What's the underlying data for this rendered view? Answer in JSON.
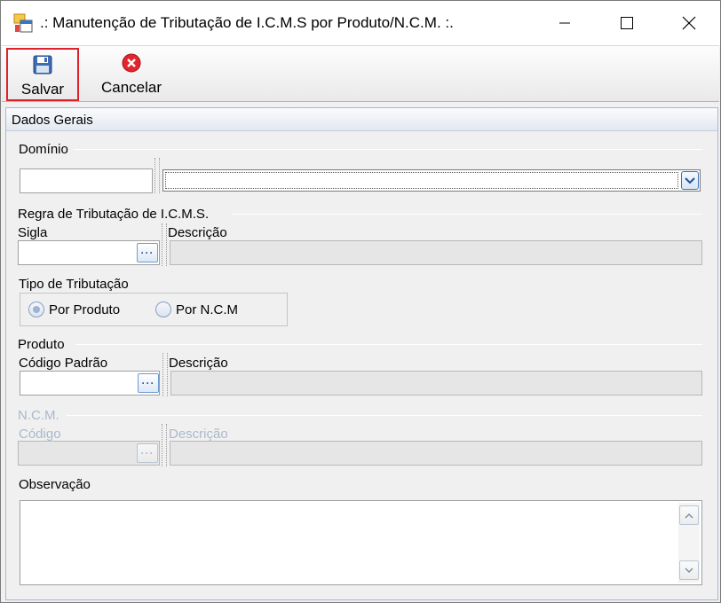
{
  "window": {
    "title": ".: Manutenção de Tributação de I.C.M.S por Produto/N.C.M. :."
  },
  "toolbar": {
    "save_label": "Salvar",
    "cancel_label": "Cancelar"
  },
  "panel": {
    "title": "Dados Gerais"
  },
  "dominio": {
    "group_label": "Domínio",
    "code_value": "",
    "selected_value": ""
  },
  "regra": {
    "group_label": "Regra de Tributação de I.C.M.S.",
    "sigla_label": "Sigla",
    "descricao_label": "Descrição",
    "sigla_value": "",
    "descricao_value": ""
  },
  "tipo": {
    "group_label": "Tipo de Tributação",
    "options": [
      "Por Produto",
      "Por N.C.M"
    ],
    "selected": "Por Produto"
  },
  "produto": {
    "group_label": "Produto",
    "codigo_label": "Código Padrão",
    "descricao_label": "Descrição",
    "codigo_value": "",
    "descricao_value": ""
  },
  "ncm": {
    "group_label": "N.C.M.",
    "codigo_label": "Código",
    "descricao_label": "Descrição",
    "codigo_value": "",
    "descricao_value": ""
  },
  "observacao": {
    "label": "Observação",
    "value": ""
  },
  "icons": {
    "app": "app-window-icon",
    "save": "floppy-disk-icon",
    "cancel": "red-x-circle-icon",
    "ellipsis": "ellipsis-icon",
    "dropdown": "chevron-down-icon"
  },
  "colors": {
    "active_button_border": "#e0202a",
    "disabled_text": "#a9b9cc",
    "accent_blue": "#3b73b9"
  }
}
